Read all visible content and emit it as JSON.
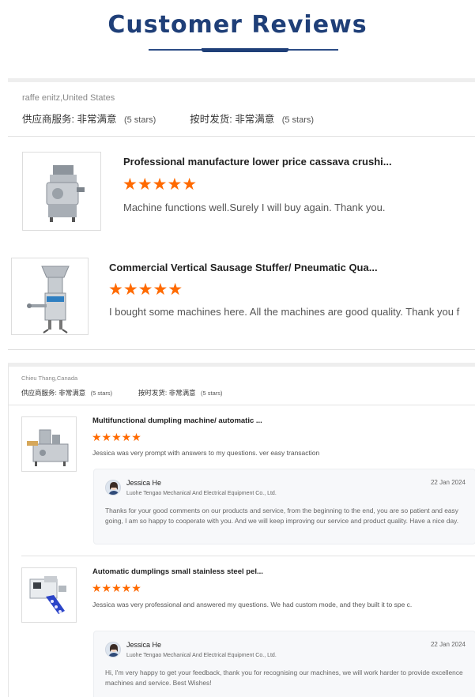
{
  "page": {
    "title": "Customer Reviews"
  },
  "colors": {
    "heading": "#1f3f78",
    "star": "#ff6a00",
    "divider": "#e3e3e3",
    "reply_bg": "#f7f8fa"
  },
  "reviews": [
    {
      "reviewer": "raffe enitz,United States",
      "supplier_service_label": "供应商服务: 非常满意",
      "supplier_service_stars": "(5 stars)",
      "ontime_delivery_label": "按时发货: 非常满意",
      "ontime_delivery_stars": "(5 stars)",
      "products": [
        {
          "image_icon": "cassava-crusher-machine-icon",
          "title": "Professional manufacture lower price cassava crushi...",
          "rating": 5,
          "stars": "★★★★★",
          "comment": "Machine functions well.Surely I will buy again. Thank you."
        },
        {
          "image_icon": "sausage-stuffer-machine-icon",
          "title": "Commercial Vertical Sausage Stuffer/ Pneumatic Qua...",
          "rating": 5,
          "stars": "★★★★★",
          "comment": "I bought some machines here. All the machines are good quality. Thank you f"
        }
      ]
    },
    {
      "reviewer": "Chieu Thang,Canada",
      "supplier_service_label": "供应商服务: 非常满意",
      "supplier_service_stars": "(5 stars)",
      "ontime_delivery_label": "按时发货: 非常满意",
      "ontime_delivery_stars": "(5 stars)",
      "products": [
        {
          "image_icon": "dumpling-machine-icon",
          "title": "Multifunctional dumpling machine/ automatic ...",
          "rating": 5,
          "stars": "★★★★★",
          "comment": "Jessica was very prompt with answers to my questions. ver easy transaction",
          "reply": {
            "name": "Jessica He",
            "company": "Luohe Tengao Mechanical And Electrical Equipment Co., Ltd.",
            "date": "22 Jan 2024",
            "body": "Thanks for your good comments on our products and service, from the beginning to the end, you are so patient and easy going, I am so happy to cooperate with you. And we will keep improving our service and product quality. Have a nice day."
          }
        },
        {
          "image_icon": "dumpling-maker-blue-icon",
          "title": "Automatic dumplings small stainless steel pel...",
          "rating": 5,
          "stars": "★★★★★",
          "comment": "Jessica was very professional and answered my questions. We had custom mode, and they built it to spe c.",
          "reply": {
            "name": "Jessica He",
            "company": "Luohe Tengao Mechanical And Electrical Equipment Co., Ltd.",
            "date": "22 Jan 2024",
            "body": "Hi, I'm very happy to get your feedback, thank you for recognising our machines, we will work harder to provide excellence machines and service. Best Wishes!"
          }
        }
      ]
    }
  ]
}
